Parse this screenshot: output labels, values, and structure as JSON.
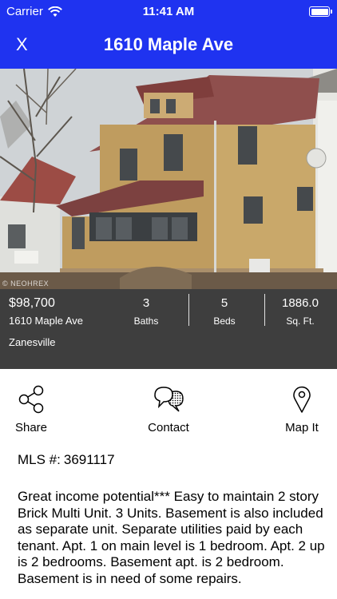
{
  "status_bar": {
    "carrier": "Carrier",
    "time": "11:41 AM",
    "battery_level": 1.0,
    "wifi_icon": "wifi-icon",
    "battery_icon": "battery-icon"
  },
  "nav": {
    "close_label": "X",
    "title": "1610 Maple Ave",
    "background": "#1f33f0"
  },
  "photo": {
    "watermark": "© NEOHREX"
  },
  "listing": {
    "price": "$98,700",
    "address": "1610 Maple Ave",
    "city": "Zanesville",
    "baths_value": "3",
    "baths_label": "Baths",
    "beds_value": "5",
    "beds_label": "Beds",
    "sqft_value": "1886.0",
    "sqft_label": "Sq. Ft."
  },
  "actions": {
    "share": {
      "label": "Share",
      "icon": "share-icon"
    },
    "contact": {
      "label": "Contact",
      "icon": "chat-bubbles-icon"
    },
    "map": {
      "label": "Map It",
      "icon": "map-pin-icon"
    }
  },
  "details": {
    "mls_label": "MLS #:",
    "mls_value": "3691117",
    "description": "Great income potential*** Easy to maintain 2 story Brick Multi Unit. 3 Units. Basement is also included as separate unit. Separate utilities paid by each tenant.  Apt. 1 on main level is 1 bedroom.  Apt. 2 up is 2 bedrooms. Basement apt. is 2 bedroom.  Basement is in need of some repairs."
  }
}
